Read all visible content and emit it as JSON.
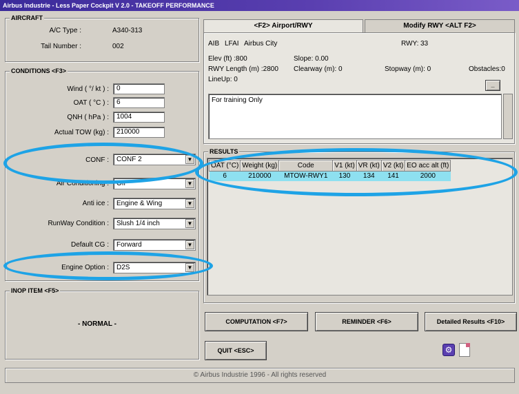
{
  "window": {
    "title": "Airbus Industrie - Less Paper Cockpit V 2.0 - TAKEOFF PERFORMANCE"
  },
  "aircraft": {
    "group_label": "AIRCRAFT",
    "ac_type_label": "A/C Type :",
    "ac_type_value": "A340-313",
    "tail_label": "Tail Number :",
    "tail_value": "002"
  },
  "conditions": {
    "group_label": "CONDITIONS <F3>",
    "wind_label": "Wind ( °/ kt ) :",
    "wind_value": "0",
    "oat_label": "OAT ( °C ) :",
    "oat_value": "6",
    "qnh_label": "QNH ( hPa ) :",
    "qnh_value": "1004",
    "tow_label": "Actual TOW (kg) :",
    "tow_value": "210000",
    "conf_label": "CONF :",
    "conf_value": "CONF 2",
    "aircond_label": "Air Conditioning :",
    "aircond_value": "Off",
    "antiice_label": "Anti ice :",
    "antiice_value": "Engine & Wing",
    "rwycond_label": "RunWay Condition :",
    "rwycond_value": "Slush 1/4 inch",
    "cg_label": "Default CG :",
    "cg_value": "Forward",
    "engopt_label": "Engine Option :",
    "engopt_value": "D2S"
  },
  "inop": {
    "group_label": "INOP ITEM <F5>",
    "status": "- NORMAL -"
  },
  "airport": {
    "tab_airport": "<F2> Airport/RWY",
    "tab_modify": "Modify RWY <ALT F2>",
    "code": "AIB",
    "icao": "LFAI",
    "city": "Airbus City",
    "rwy_label": "RWY:",
    "rwy_value": "33",
    "elev": "Elev (ft) :800",
    "slope": "Slope: 0.00",
    "rwy_length": "RWY Length (m) :2800",
    "clearway": "Clearway (m): 0",
    "stopway": "Stopway (m): 0",
    "obstacles": "Obstacles:0",
    "lineup": "LineUp: 0",
    "notes": "For training Only"
  },
  "results": {
    "group_label": "RESULTS",
    "columns": [
      "OAT (°C)",
      "Weight (kg)",
      "Code",
      "V1 (kt)",
      "VR (kt)",
      "V2 (kt)",
      "EO acc alt (ft)"
    ],
    "rows": [
      [
        "6",
        "210000",
        "MTOW-RWY1",
        "130",
        "134",
        "141",
        "2000"
      ]
    ]
  },
  "buttons": {
    "computation": "COMPUTATION <F7>",
    "reminder": "REMINDER <F6>",
    "detailed": "Detailed Results <F10>",
    "quit": "QUIT <ESC>"
  },
  "footer": {
    "copyright": "© Airbus Industrie 1996 - All rights reserved"
  },
  "colors": {
    "highlight_ellipse": "#1ea3e6",
    "result_row": "#8ee0f0",
    "titlebar": "#3a2a9a"
  }
}
